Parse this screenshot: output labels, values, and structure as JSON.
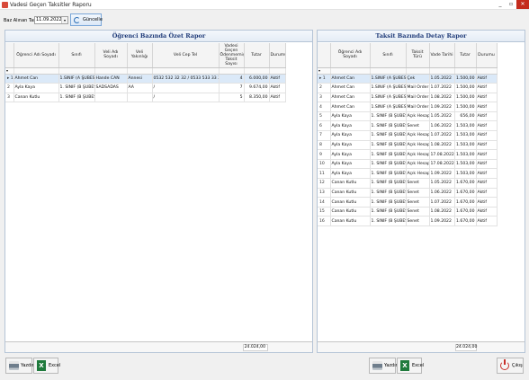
{
  "window": {
    "title": "Vadesi Geçen Taksitler Raporu",
    "min": "_",
    "max": "▫",
    "close": "✕"
  },
  "filter": {
    "label": "Baz Alınan Tarih",
    "date": "11.09.2022",
    "dropdown_icon": "▾",
    "refresh_label": "Güncelle"
  },
  "left_panel": {
    "title": "Öğrenci Bazında Özet Rapor",
    "columns": [
      "Öğrenci Adı Soyadı",
      "Sınıfı",
      "Veli Adı Soyadı",
      "Veli Yakınlığı",
      "Veli Cep Tel",
      "Vadesi Geçen Ödenmemiş Taksit Sayısı",
      "Tutar",
      "Durumu"
    ],
    "rows": [
      {
        "rh": "▸ 1",
        "cells": [
          "Ahmet Can",
          "1.SINIF (A ŞUBESİ)",
          "Hande CAN",
          "Annesi",
          "0532 532 32 32 / 0533 533 33 33",
          "4",
          "6.000,00",
          "Aktif"
        ]
      },
      {
        "rh": "2",
        "cells": [
          "Ayla Kaya",
          "1. SINIF (B ŞUBESİ)",
          "SADSADAS",
          "AA",
          "/",
          "7",
          "9.674,00",
          "Aktif"
        ]
      },
      {
        "rh": "3",
        "cells": [
          "Canan Kutlu",
          "1. SINIF (B ŞUBESİ)",
          "",
          "",
          "/",
          "5",
          "8.350,00",
          "Aktif"
        ]
      }
    ],
    "total": "24.024,00"
  },
  "right_panel": {
    "title": "Taksit Bazında Detay Rapor",
    "columns": [
      "Öğrenci Adı Soyadı",
      "Sınıfı",
      "Taksit Türü",
      "Vade Tarihi",
      "Tutar",
      "Durumu"
    ],
    "rows": [
      {
        "rh": "▸ 1",
        "cells": [
          "Ahmet Can",
          "1.SINIF (A ŞUBESİ)",
          "Çek",
          "1.05.2022",
          "1.500,00",
          "Aktif"
        ]
      },
      {
        "rh": "2",
        "cells": [
          "Ahmet Can",
          "1.SINIF (A ŞUBESİ)",
          "Mail Order",
          "1.07.2022",
          "1.500,00",
          "Aktif"
        ]
      },
      {
        "rh": "3",
        "cells": [
          "Ahmet Can",
          "1.SINIF (A ŞUBESİ)",
          "Mail Order",
          "1.08.2022",
          "1.500,00",
          "Aktif"
        ]
      },
      {
        "rh": "4",
        "cells": [
          "Ahmet Can",
          "1.SINIF (A ŞUBESİ)",
          "Mail Order",
          "1.09.2022",
          "1.500,00",
          "Aktif"
        ]
      },
      {
        "rh": "5",
        "cells": [
          "Ayla Kaya",
          "1. SINIF (B ŞUBESİ)",
          "Açık Hesap",
          "1.05.2022",
          "656,00",
          "Aktif"
        ]
      },
      {
        "rh": "6",
        "cells": [
          "Ayla Kaya",
          "1. SINIF (B ŞUBESİ)",
          "Senet",
          "1.06.2022",
          "1.503,00",
          "Aktif"
        ]
      },
      {
        "rh": "7",
        "cells": [
          "Ayla Kaya",
          "1. SINIF (B ŞUBESİ)",
          "Açık Hesap",
          "1.07.2022",
          "1.503,00",
          "Aktif"
        ]
      },
      {
        "rh": "8",
        "cells": [
          "Ayla Kaya",
          "1. SINIF (B ŞUBESİ)",
          "Açık Hesap",
          "1.08.2022",
          "1.503,00",
          "Aktif"
        ]
      },
      {
        "rh": "9",
        "cells": [
          "Ayla Kaya",
          "1. SINIF (B ŞUBESİ)",
          "Açık Hesap",
          "17.08.2022",
          "1.503,00",
          "Aktif"
        ]
      },
      {
        "rh": "10",
        "cells": [
          "Ayla Kaya",
          "1. SINIF (B ŞUBESİ)",
          "Açık Hesap",
          "17.08.2022",
          "1.503,00",
          "Aktif"
        ]
      },
      {
        "rh": "11",
        "cells": [
          "Ayla Kaya",
          "1. SINIF (B ŞUBESİ)",
          "Açık Hesap",
          "1.09.2022",
          "1.503,00",
          "Aktif"
        ]
      },
      {
        "rh": "12",
        "cells": [
          "Canan Kutlu",
          "1. SINIF (B ŞUBESİ)",
          "Senet",
          "1.05.2022",
          "1.670,00",
          "Aktif"
        ]
      },
      {
        "rh": "13",
        "cells": [
          "Canan Kutlu",
          "1. SINIF (B ŞUBESİ)",
          "Senet",
          "1.06.2022",
          "1.670,00",
          "Aktif"
        ]
      },
      {
        "rh": "14",
        "cells": [
          "Canan Kutlu",
          "1. SINIF (B ŞUBESİ)",
          "Senet",
          "1.07.2022",
          "1.670,00",
          "Aktif"
        ]
      },
      {
        "rh": "15",
        "cells": [
          "Canan Kutlu",
          "1. SINIF (B ŞUBESİ)",
          "Senet",
          "1.08.2022",
          "1.670,00",
          "Aktif"
        ]
      },
      {
        "rh": "16",
        "cells": [
          "Canan Kutlu",
          "1. SINIF (B ŞUBESİ)",
          "Senet",
          "1.09.2022",
          "1.670,00",
          "Aktif"
        ]
      }
    ],
    "total": "24.024,00"
  },
  "buttons": {
    "print": "Yazdır",
    "excel": "Excel",
    "exit": "Çıkış",
    "excel_glyph": "X"
  }
}
